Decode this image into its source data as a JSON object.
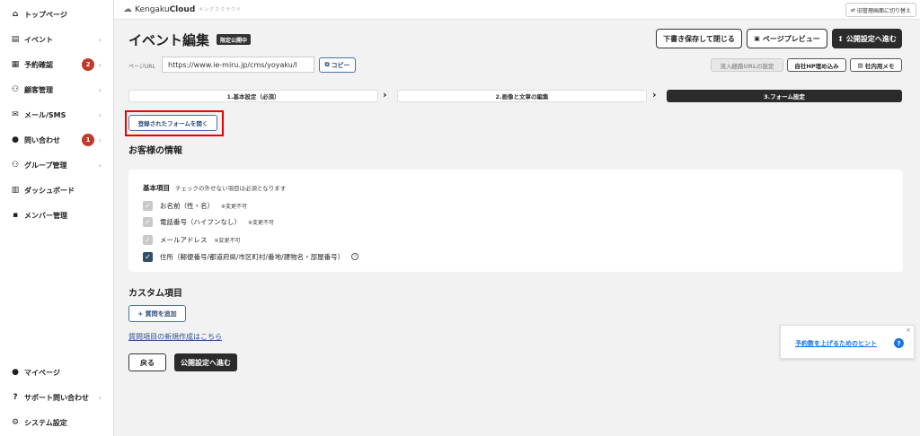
{
  "sidebar": {
    "items": [
      {
        "label": "トップページ",
        "icon": "home-icon"
      },
      {
        "label": "イベント",
        "icon": "document-icon"
      },
      {
        "label": "予約確認",
        "icon": "calendar-icon",
        "badge": "2"
      },
      {
        "label": "顧客管理",
        "icon": "users-icon"
      },
      {
        "label": "メール/SMS",
        "icon": "mail-icon"
      },
      {
        "label": "問い合わせ",
        "icon": "chat-icon",
        "badge": "1"
      },
      {
        "label": "グループ管理",
        "icon": "group-icon"
      },
      {
        "label": "ダッシュボード",
        "icon": "dashboard-icon"
      },
      {
        "label": "メンバー管理",
        "icon": "grid-icon"
      }
    ],
    "bottom_items": [
      {
        "label": "マイページ",
        "icon": "user-icon"
      },
      {
        "label": "サポート問い合わせ",
        "icon": "help-icon"
      },
      {
        "label": "システム設定",
        "icon": "gear-icon"
      }
    ]
  },
  "topbar": {
    "logo_prefix": "Kengaku",
    "logo_bold": "Cloud",
    "logo_sub": "キングカクラウド",
    "old_admin_label": "旧管理画面に切り替え"
  },
  "header": {
    "title": "イベント編集",
    "badge": "限定公開中",
    "save_close_label": "下書き保存して閉じる",
    "preview_label": "ページプレビュー",
    "proceed_label": "公開設定へ進む"
  },
  "url_bar": {
    "label": "ページURL",
    "value": "https://www.ie-miru.jp/cms/yoyaku/l",
    "copy_label": "コピー",
    "inflow_label": "流入経路URLの設定",
    "embed_label": "自社HP埋め込み",
    "memo_label": "社内用メモ"
  },
  "steps": [
    {
      "label": "1.基本設定（必須）"
    },
    {
      "label": "2.画像と文章の編集"
    },
    {
      "label": "3.フォーム設定"
    }
  ],
  "open_form_label": "登録されたフォームを開く",
  "customer_section": {
    "title": "お客様の情報",
    "card_title": "基本項目",
    "card_note": "チェックの外せない項目は必須となります",
    "fields": [
      {
        "label": "お名前（性・名）",
        "tag": "※変更不可",
        "checked": true,
        "locked": true
      },
      {
        "label": "電話番号（ハイフンなし）",
        "tag": "※変更不可",
        "checked": true,
        "locked": true
      },
      {
        "label": "メールアドレス",
        "tag": "※変更不可",
        "checked": true,
        "locked": true
      },
      {
        "label": "住所（郵便番号/都道府県/市区町村/番地/建物名・部屋番号）",
        "tag": "",
        "checked": true,
        "locked": false
      }
    ]
  },
  "custom_section": {
    "title": "カスタム項目",
    "add_question_label": "+ 質問を追加",
    "new_question_link": "質問項目の新規作成はこちら"
  },
  "footer_buttons": {
    "back_label": "戻る",
    "proceed_label": "公開設定へ進む"
  },
  "hint": {
    "link": "予約数を上げるためのヒント",
    "help": "?",
    "close": "×"
  }
}
